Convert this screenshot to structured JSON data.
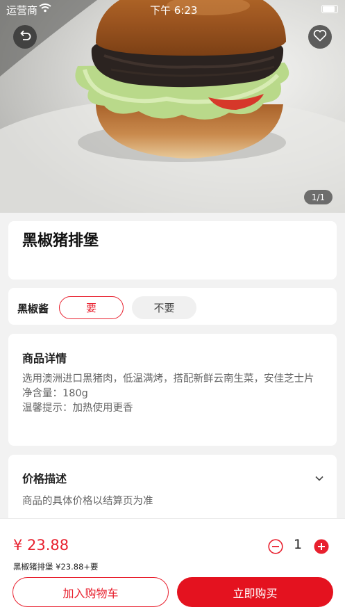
{
  "status_bar": {
    "carrier": "运营商",
    "time": "下午 6:23"
  },
  "gallery": {
    "pager": "1/1",
    "image": "burger-photo"
  },
  "product": {
    "title": "黑椒猪排堡"
  },
  "options": {
    "label": "黑椒酱",
    "choices": [
      {
        "label": "要",
        "selected": true
      },
      {
        "label": "不要",
        "selected": false
      }
    ]
  },
  "details": {
    "title": "商品详情",
    "lines": [
      "选用澳洲进口黑猪肉，低温满烤，搭配新鲜云南生菜，安佳芝士片",
      "净含量：180g",
      "温馨提示：加热使用更香"
    ]
  },
  "price_section": {
    "title": "价格描述",
    "description": "商品的具体价格以结算页为准"
  },
  "cart_bar": {
    "price": "¥ 23.88",
    "summary": "黑椒猪排堡 ¥23.88+要",
    "quantity": "1",
    "add_to_cart": "加入购物车",
    "buy_now": "立即购买"
  },
  "colors": {
    "accent": "#e8202e",
    "button": "#e4121f"
  },
  "icons": [
    "back-icon",
    "heart-icon",
    "wifi-icon",
    "battery-icon",
    "chevron-down-icon",
    "minus-circle-icon",
    "plus-circle-icon"
  ]
}
